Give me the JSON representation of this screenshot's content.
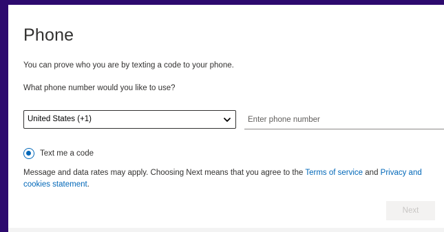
{
  "page": {
    "title": "Phone",
    "description": "You can prove who you are by texting a code to your phone.",
    "question": "What phone number would you like to use?"
  },
  "form": {
    "country_select_value": "United States (+1)",
    "phone_placeholder": "Enter phone number",
    "phone_value": "",
    "method_label": "Text me a code",
    "method_selected": true
  },
  "disclaimer": {
    "prefix": "Message and data rates may apply. Choosing Next means that you agree to the ",
    "terms_link": "Terms of service",
    "middle": " and ",
    "privacy_link": "Privacy and cookies statement",
    "suffix": "."
  },
  "actions": {
    "next_label": "Next"
  },
  "colors": {
    "background": "#2d0a6e",
    "accent": "#0067b8",
    "disabled_button_bg": "#f3f2f1",
    "disabled_button_text": "#c8c6c4"
  },
  "icons": {
    "select_chevron": "chevron-down-icon",
    "radio": "radio-selected-icon"
  }
}
